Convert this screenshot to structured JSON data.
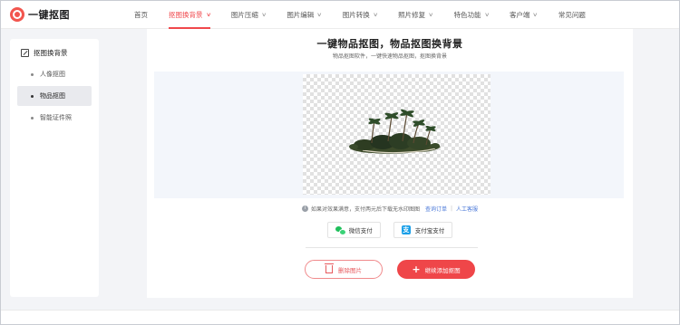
{
  "app": {
    "name": "一键抠图"
  },
  "nav": {
    "items": [
      {
        "label": "首页",
        "chevron": false,
        "active": false
      },
      {
        "label": "抠图换背景",
        "chevron": true,
        "active": true
      },
      {
        "label": "图片压缩",
        "chevron": true,
        "active": false
      },
      {
        "label": "图片编辑",
        "chevron": true,
        "active": false
      },
      {
        "label": "图片转换",
        "chevron": true,
        "active": false
      },
      {
        "label": "照片修复",
        "chevron": true,
        "active": false
      },
      {
        "label": "特色功能",
        "chevron": true,
        "active": false
      },
      {
        "label": "客户端",
        "chevron": true,
        "active": false
      },
      {
        "label": "常见问题",
        "chevron": false,
        "active": false
      }
    ]
  },
  "sidebar": {
    "heading": "抠图换背景",
    "items": [
      {
        "label": "人像抠图",
        "active": false
      },
      {
        "label": "物品抠图",
        "active": true
      },
      {
        "label": "智能证件照",
        "active": false
      }
    ]
  },
  "main": {
    "title": "一键物品抠图，物品抠图换背景",
    "subtitle": "物品抠图软件，一键快速物品抠图，抠图换背景",
    "notice": {
      "text": "如果对效果满意，支付两元后下载无水印图图",
      "order_link": "查询订单",
      "separator": "|",
      "support_link": "人工客服"
    },
    "payment": {
      "wechat_label": "微信支付",
      "alipay_label": "支付宝支付",
      "alipay_glyph": "支"
    },
    "actions": {
      "delete_label": "删除图片",
      "add_label": "继续添加抠图"
    }
  },
  "colors": {
    "accent": "#ef4649",
    "link": "#4a78d8",
    "wechat": "#1fbf5b",
    "alipay": "#1a9fe8"
  }
}
